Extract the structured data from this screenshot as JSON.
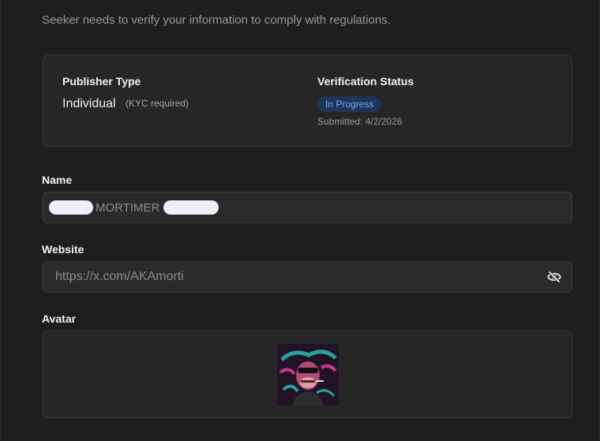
{
  "intro_text": "Seeker needs to verify your information to comply with regulations.",
  "publisher": {
    "label": "Publisher Type",
    "value": "Individual",
    "note": "(KYC required)"
  },
  "verification": {
    "label": "Verification Status",
    "status": "In Progress",
    "submitted": "Submitted: 4/2/2026",
    "status_color": "#6ea8ff",
    "status_bg": "#1f3558"
  },
  "name_field": {
    "label": "Name",
    "visible_value": "MORTIMER"
  },
  "website_field": {
    "label": "Website",
    "value": "https://x.com/AKAmorti",
    "toggle_icon": "eye-slash-icon"
  },
  "avatar_field": {
    "label": "Avatar",
    "image": "bored-ape-avatar"
  }
}
